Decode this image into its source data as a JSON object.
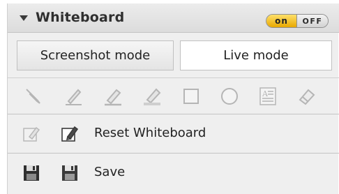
{
  "panel": {
    "title": "Whiteboard",
    "toggle": {
      "on_label": "on",
      "off_label": "OFF",
      "state": "on"
    }
  },
  "modes": {
    "screenshot_label": "Screenshot mode",
    "live_label": "Live mode",
    "selected": "Live mode"
  },
  "tools": [
    {
      "icon": "pointer-tool-icon"
    },
    {
      "icon": "pen-tool-icon"
    },
    {
      "icon": "highlighter-tool-icon"
    },
    {
      "icon": "marker-tool-icon"
    },
    {
      "icon": "rectangle-tool-icon"
    },
    {
      "icon": "ellipse-tool-icon"
    },
    {
      "icon": "text-tool-icon"
    },
    {
      "icon": "eraser-tool-icon"
    }
  ],
  "actions": {
    "reset_label": "Reset Whiteboard",
    "save_label": "Save"
  },
  "colors": {
    "toggle_on": "#f0b800",
    "panel_bg": "#efefef",
    "disabled_icon": "#b8b8b8"
  }
}
